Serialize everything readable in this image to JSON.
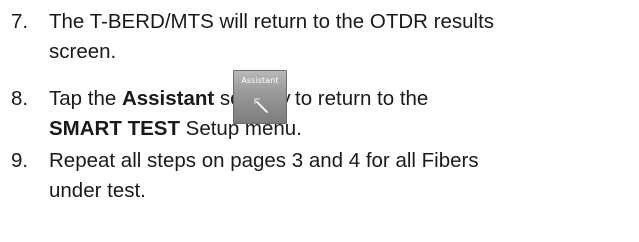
{
  "steps": [
    {
      "number": "7.",
      "lines": [
        "The T-BERD/MTS will return to the OTDR results",
        "screen."
      ]
    },
    {
      "number": "8.",
      "line1": {
        "pre": "Tap the ",
        "bold1": "Assistant",
        "mid": " soft key",
        "post": " to return to the"
      },
      "line2": {
        "bold": "SMART TEST",
        "rest": " Setup menu."
      },
      "softkey": {
        "label": "Assistant",
        "icon": "magic-wand-icon"
      }
    },
    {
      "number": "9.",
      "lines": [
        "Repeat all steps on pages 3 and 4 for all Fibers",
        "under test."
      ]
    }
  ]
}
